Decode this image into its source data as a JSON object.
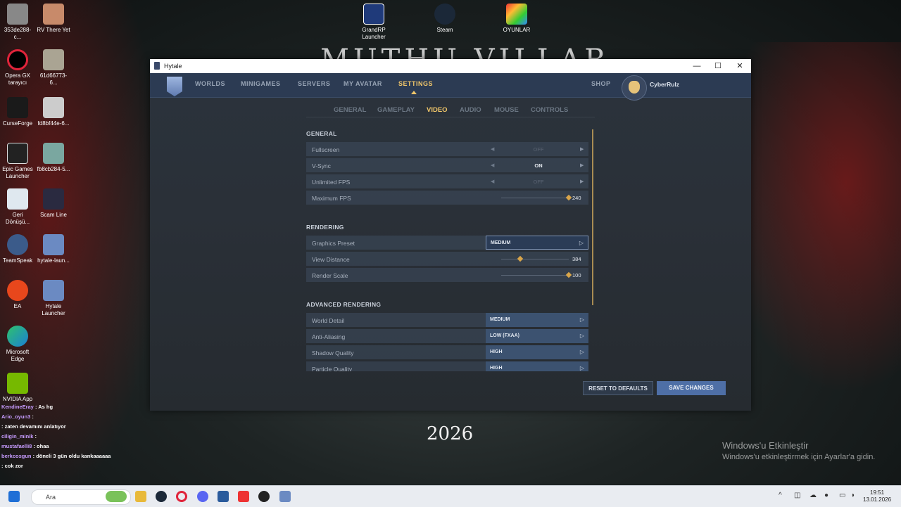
{
  "desktop": {
    "wallpaper_title": "MUTHU VILLAR",
    "wallpaper_year": "2026",
    "activation_title": "Windows'u Etkinleştir",
    "activation_sub": "Windows'u etkinleştirmek için Ayarlar'a gidin.",
    "icons": [
      {
        "label": "353de288-c..."
      },
      {
        "label": "RV There Yet"
      },
      {
        "label": "Opera GX tarayıcı"
      },
      {
        "label": "61d66773-6..."
      },
      {
        "label": "CurseForge"
      },
      {
        "label": "fd8bf44e-6..."
      },
      {
        "label": "Epic Games Launcher"
      },
      {
        "label": "fb8cb284-5..."
      },
      {
        "label": "Geri Dönüşü..."
      },
      {
        "label": "Scam Line"
      },
      {
        "label": "TeamSpeak"
      },
      {
        "label": "hytale-laun..."
      },
      {
        "label": "EA"
      },
      {
        "label": "Hytale Launcher"
      },
      {
        "label": "Microsoft Edge"
      },
      {
        "label": "NVIDIA App"
      },
      {
        "label": "GrandRP Launcher"
      },
      {
        "label": "Steam"
      },
      {
        "label": "OYUNLAR"
      }
    ]
  },
  "chat": [
    {
      "user": "KendineEray",
      "msg": ": As hg"
    },
    {
      "user": "Ario_oyun3",
      "msg": ":"
    },
    {
      "user": "",
      "msg": ": zaten devamını anlatıyor"
    },
    {
      "user": "ciligin_minik",
      "msg": ":"
    },
    {
      "user": "mustafaelli8",
      "msg": ": ohaa"
    },
    {
      "user": "berkcosgun",
      "msg": ": döneli 3 gün oldu kankaaaaaa"
    },
    {
      "user": "",
      "msg": ": cok zor"
    }
  ],
  "window": {
    "title": "Hytale",
    "minimize": "—",
    "maximize": "☐",
    "close": "✕"
  },
  "nav": {
    "items": [
      "WORLDS",
      "MINIGAMES",
      "SERVERS",
      "MY AVATAR",
      "SETTINGS"
    ],
    "shop": "SHOP",
    "username": "CyberRulz"
  },
  "subtabs": [
    "GENERAL",
    "GAMEPLAY",
    "VIDEO",
    "AUDIO",
    "MOUSE",
    "CONTROLS"
  ],
  "sections": {
    "general": "GENERAL",
    "rendering": "RENDERING",
    "advanced": "ADVANCED RENDERING"
  },
  "settings": {
    "fullscreen": {
      "label": "Fullscreen",
      "value": "OFF"
    },
    "vsync": {
      "label": "V-Sync",
      "value": "ON"
    },
    "unlimited_fps": {
      "label": "Unlimited FPS",
      "value": "OFF"
    },
    "max_fps": {
      "label": "Maximum FPS",
      "value": "240"
    },
    "graphics_preset": {
      "label": "Graphics Preset",
      "value": "MEDIUM"
    },
    "view_distance": {
      "label": "View Distance",
      "value": "384"
    },
    "render_scale": {
      "label": "Render Scale",
      "value": "100"
    },
    "world_detail": {
      "label": "World Detail",
      "value": "MEDIUM"
    },
    "anti_aliasing": {
      "label": "Anti-Aliasing",
      "value": "LOW (FXAA)"
    },
    "shadow_quality": {
      "label": "Shadow Quality",
      "value": "HIGH"
    },
    "particle_quality": {
      "label": "Particle Quality",
      "value": "HIGH"
    }
  },
  "buttons": {
    "reset": "RESET TO DEFAULTS",
    "save": "SAVE CHANGES"
  },
  "taskbar": {
    "search_placeholder": "Ara",
    "time": "19:51",
    "date": "13.01.2026"
  },
  "colors": {
    "accent": "#f0c66a",
    "nav_bg": "#2c3b53",
    "save_button": "#4e6fa6"
  }
}
